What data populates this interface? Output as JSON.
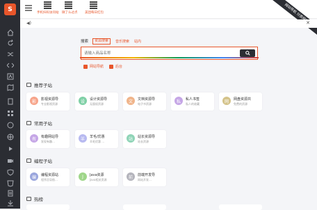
{
  "sidebar": {
    "logo": "S",
    "icons": [
      "home-icon",
      "refresh-icon",
      "shuffle-icon",
      "code-icon",
      "font-icon",
      "map-icon",
      "book-icon",
      "grid-icon",
      "apps-icon",
      "globe-icon",
      "play-icon",
      "video-icon",
      "shield-icon",
      "html5-icon",
      "file-icon",
      "phone-icon",
      "mail-icon",
      "download-icon"
    ]
  },
  "topbar": {
    "qr_items": [
      {
        "label": "手机扫码访问站"
      },
      {
        "label": "微了么过点"
      },
      {
        "label": "美团每日红包"
      }
    ],
    "ribbon": "网站导航 分类网站"
  },
  "search": {
    "label": "搜索",
    "tabs": [
      "资源搜索",
      "音乐搜索",
      "站内"
    ],
    "placeholder": "请输入商品名称",
    "hot_links": [
      "网站导航",
      "后台"
    ]
  },
  "sections": [
    {
      "title": "推荐子站",
      "cards": [
        {
          "icon": "影",
          "title": "影视资源导",
          "desc": "专业影视资源",
          "color": "#f7a48a"
        },
        {
          "icon": "设",
          "title": "设计资源导",
          "desc": "无版权资源",
          "color": "#7fd0a6"
        },
        {
          "icon": "文",
          "title": "文档资源导",
          "desc": "电子书资源",
          "color": "#f0b48a"
        },
        {
          "icon": "私",
          "title": "私人书签",
          "desc": "私人的收藏",
          "color": "#c5a6e6"
        },
        {
          "icon": "网",
          "title": "网盘资源共",
          "desc": "免费的资源",
          "color": "#d4c38a"
        }
      ]
    },
    {
      "title": "常用子站",
      "cards": [
        {
          "icon": "有",
          "title": "有趣网站导",
          "desc": "发现有趣…",
          "color": "#c5a6e6"
        },
        {
          "icon": "羊",
          "title": "羊毛/优惠",
          "desc": "羊毛优惠 …",
          "color": "#b7b9f0"
        },
        {
          "icon": "站",
          "title": "站长资源导",
          "desc": "站长资源",
          "color": "#8fd4b7"
        }
      ]
    },
    {
      "title": "编程子站",
      "cards": [
        {
          "icon": "编",
          "title": "编程资源站",
          "desc": "程序员导航…",
          "color": "#9aa6dd"
        },
        {
          "icon": "J",
          "title": "Java资源",
          "desc": "Java相关资源",
          "color": "#9fd68a"
        },
        {
          "icon": "前",
          "title": "前端开发导",
          "desc": "网站开发…",
          "color": "#b4b4bc"
        }
      ]
    },
    {
      "title": "热榜",
      "cards": []
    }
  ]
}
